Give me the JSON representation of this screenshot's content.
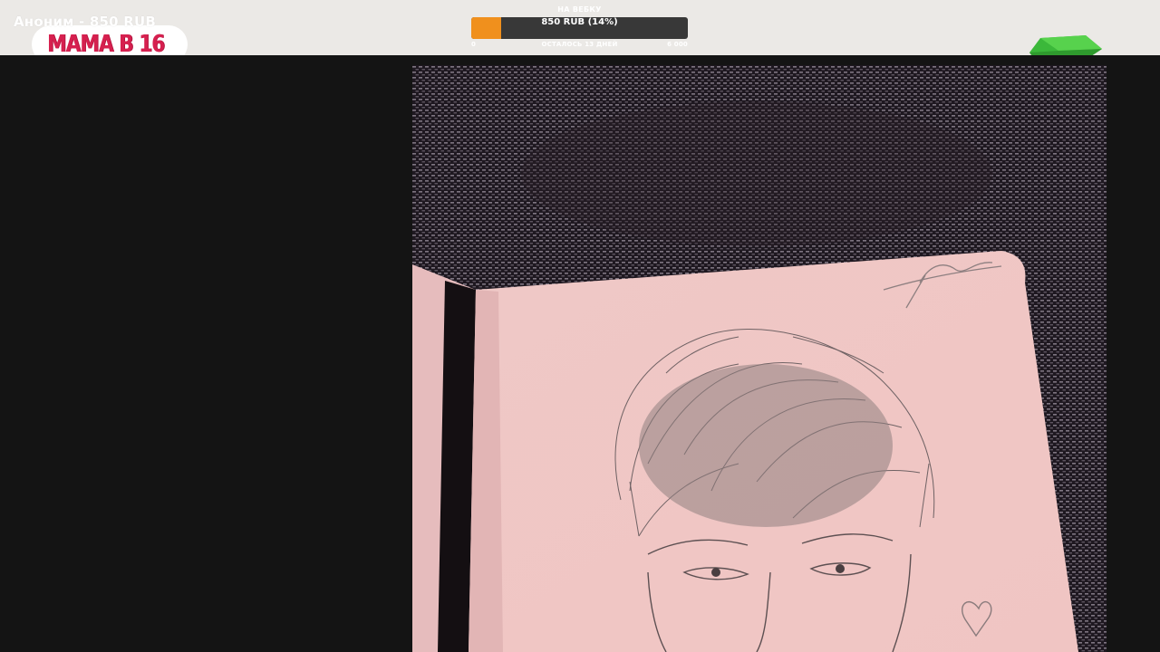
{
  "overlay": {
    "donation_text": "Аноним - 850 RUB",
    "logo_text": "МАМА В 16"
  },
  "goal": {
    "title": "НА ВЕБКУ",
    "bar_label": "850 RUB (14%)",
    "progress_fraction": 0.14,
    "min_label": "0",
    "remaining_label": "ОСТАЛОСЬ 13 ДНЕЙ",
    "max_label": "6 000"
  },
  "colors": {
    "goal_fill": "#f0901d",
    "goal_track": "#383838",
    "logo": "#d6204f",
    "topbar": "#ebe9e6",
    "background": "#141414"
  },
  "icons": [
    "green-gift-icon"
  ]
}
